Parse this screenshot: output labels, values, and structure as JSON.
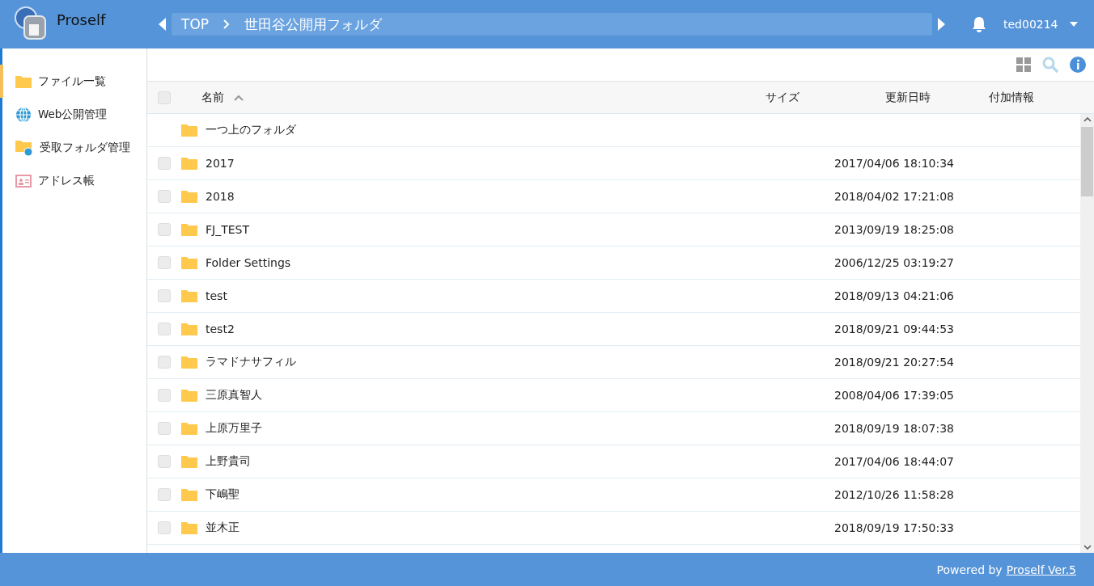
{
  "header": {
    "app_name": "Proself",
    "breadcrumb": [
      {
        "label": "TOP"
      },
      {
        "label": "世田谷公開用フォルダ"
      }
    ],
    "user": "ted00214"
  },
  "sidebar": {
    "items": [
      {
        "label": "ファイル一覧",
        "kind": "folder",
        "selected": true
      },
      {
        "label": "Web公開管理",
        "kind": "globe",
        "selected": false
      },
      {
        "label": "受取フォルダ管理",
        "kind": "folder-globe",
        "selected": false
      },
      {
        "label": "アドレス帳",
        "kind": "card",
        "selected": false
      }
    ]
  },
  "table": {
    "select_all_checked": false,
    "columns": [
      {
        "label": "名前",
        "sorted": true
      },
      {
        "label": "サイズ",
        "sorted": false
      },
      {
        "label": "更新日時",
        "sorted": false
      },
      {
        "label": "付加情報",
        "sorted": false
      }
    ],
    "parent_row": {
      "name": "一つ上のフォルダ"
    },
    "rows": [
      {
        "name": "2017",
        "modified": "2017/04/06 18:10:34",
        "checked": false
      },
      {
        "name": "2018",
        "modified": "2018/04/02 17:21:08",
        "checked": false
      },
      {
        "name": "FJ_TEST",
        "modified": "2013/09/19 18:25:08",
        "checked": false
      },
      {
        "name": "Folder Settings",
        "modified": "2006/12/25 03:19:27",
        "checked": false
      },
      {
        "name": "test",
        "modified": "2018/09/13 04:21:06",
        "checked": false
      },
      {
        "name": "test2",
        "modified": "2018/09/21 09:44:53",
        "checked": false
      },
      {
        "name": "ラマドナサフィル",
        "modified": "2018/09/21 20:27:54",
        "checked": false
      },
      {
        "name": "三原真智人",
        "modified": "2008/04/06 17:39:05",
        "checked": false
      },
      {
        "name": "上原万里子",
        "modified": "2018/09/19 18:07:38",
        "checked": false
      },
      {
        "name": "上野貴司",
        "modified": "2017/04/06 18:44:07",
        "checked": false
      },
      {
        "name": "下嶋聖",
        "modified": "2012/10/26 11:58:28",
        "checked": false
      },
      {
        "name": "並木正",
        "modified": "2018/09/19 17:50:33",
        "checked": false
      }
    ]
  },
  "footer": {
    "text": "Powered by",
    "link": "Proself Ver.5"
  }
}
